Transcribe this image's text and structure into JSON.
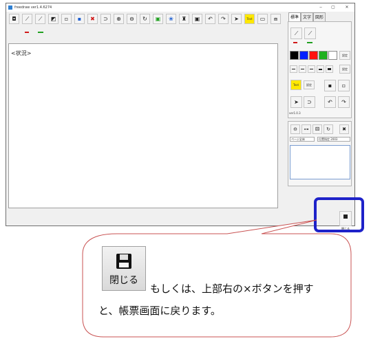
{
  "window": {
    "title": "freedraw ver1.4.6274",
    "controls": [
      "‒",
      "▢",
      "✕"
    ]
  },
  "toolbar": {
    "buttons": [
      {
        "name": "camera",
        "glyph": "📷"
      },
      {
        "name": "brush",
        "glyph": "✎"
      },
      {
        "name": "pen",
        "glyph": "✒"
      },
      {
        "name": "fill",
        "glyph": "◩"
      },
      {
        "name": "copy",
        "glyph": "⧉"
      },
      {
        "name": "paste",
        "glyph": "⧉"
      },
      {
        "name": "delete",
        "glyph": "✖"
      },
      {
        "name": "lasso",
        "glyph": "⊃"
      },
      {
        "name": "zoom-in",
        "glyph": "⊕"
      },
      {
        "name": "zoom-out",
        "glyph": "⊖"
      },
      {
        "name": "zoom-reset",
        "glyph": "⟳"
      },
      {
        "name": "layer",
        "glyph": "⧉"
      },
      {
        "name": "group",
        "glyph": "❀"
      },
      {
        "name": "stamp",
        "glyph": "♜"
      },
      {
        "name": "window",
        "glyph": "▣"
      },
      {
        "name": "undo",
        "glyph": "↶"
      },
      {
        "name": "redo",
        "glyph": "↷"
      },
      {
        "name": "pointer",
        "glyph": "➤"
      },
      {
        "name": "text",
        "glyph": "Text"
      },
      {
        "name": "ruler",
        "glyph": "▭"
      },
      {
        "name": "screen",
        "glyph": "⧈"
      }
    ]
  },
  "canvas": {
    "status_label": "<状況>"
  },
  "panel": {
    "tabs": [
      "標準",
      "文字",
      "図形"
    ],
    "set_label": "設定",
    "text_tool": "Text",
    "version": "ver1.0.3",
    "colors": [
      "#000000",
      "#0020ff",
      "#ff1010",
      "#20b020",
      "#ffffff"
    ],
    "selects": [
      "ページ全体",
      "位置指定 2003"
    ],
    "close_label": "閉じる"
  },
  "callout": {
    "button_label": "閉じる",
    "line1": "もしくは、上部右の×ボタンを押す",
    "line2": "と、帳票画面に戻ります。"
  },
  "accent": {
    "highlight": "#1e22c9",
    "callout_border": "#c85050"
  }
}
